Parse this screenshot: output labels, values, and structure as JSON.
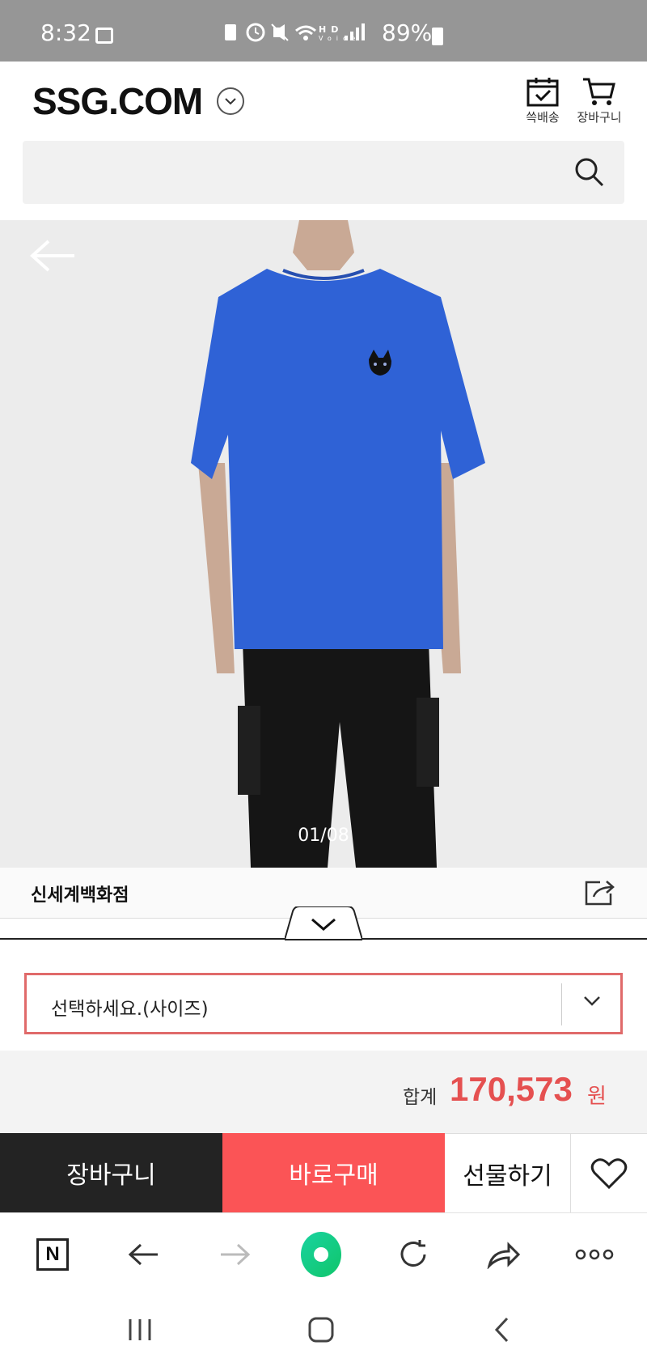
{
  "status_bar": {
    "time": "8:32",
    "icons": [
      "gallery-icon",
      "battery-saver-icon",
      "alarm-icon",
      "mute-icon",
      "wifi-icon",
      "hd-voice-icon",
      "signal-icon"
    ],
    "battery_percent": "89%"
  },
  "header": {
    "logo": "SSG.COM",
    "quick_delivery_label": "쓱배송",
    "cart_label": "장바구니"
  },
  "search": {
    "placeholder": "",
    "value": ""
  },
  "product": {
    "image_counter": "01/08",
    "image_desc_icon": "product-photo",
    "tshirt_color": "#2f62d6"
  },
  "store": {
    "name": "신세계백화점"
  },
  "option": {
    "selected": "선택하세요.(사이즈)"
  },
  "total": {
    "label": "합계",
    "price": "170,573",
    "unit": "원"
  },
  "actions": {
    "cart": "장바구니",
    "buy_now": "바로구매",
    "gift": "선물하기"
  },
  "colors": {
    "accent": "#fb5456",
    "price": "#e55050",
    "dark_button": "#232323"
  }
}
